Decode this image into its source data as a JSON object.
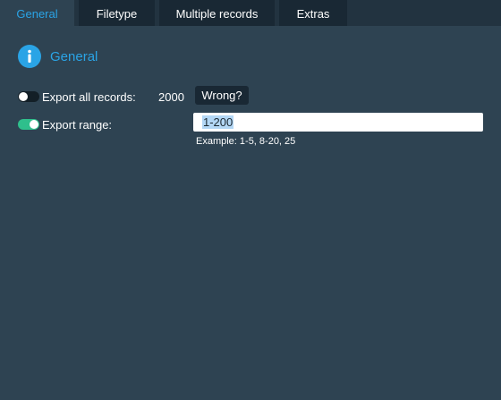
{
  "tabs": [
    {
      "label": "General",
      "active": true
    },
    {
      "label": "Filetype",
      "active": false
    },
    {
      "label": "Multiple records",
      "active": false
    },
    {
      "label": "Extras",
      "active": false
    }
  ],
  "section": {
    "title": "General",
    "icon": "info-icon"
  },
  "export_all": {
    "label": "Export all records:",
    "enabled": false,
    "count": "2000",
    "wrong_label": "Wrong?"
  },
  "export_range": {
    "label": "Export range:",
    "enabled": true,
    "value": "1-200",
    "example": "Example: 1-5, 8-20, 25"
  },
  "colors": {
    "background": "#2e4352",
    "accent": "#2aa4e6",
    "toggle_on": "#2fbf8c"
  }
}
